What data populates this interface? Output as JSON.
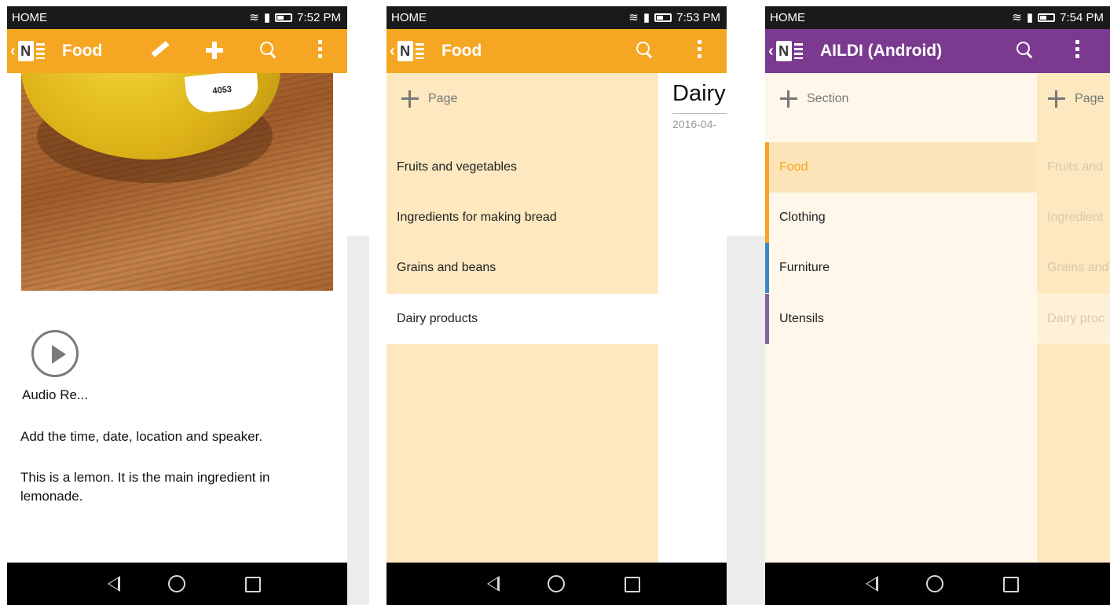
{
  "colors": {
    "food_orange": "#f5a623",
    "notebook_purple": "#7b3a8f",
    "clothing_accent": "#f5a623",
    "furniture_accent": "#3d86c6",
    "utensils_accent": "#8064a2"
  },
  "screen1": {
    "status": {
      "home": "HOME",
      "time": "7:52 PM"
    },
    "appbar": {
      "title": "Food"
    },
    "image_alt_text": {
      "sticker": "4053"
    },
    "audio": {
      "label": "Audio Re..."
    },
    "paragraphs": [
      "Add the time, date, location and speaker.",
      "This is a lemon. It is the main ingredient in lemonade."
    ]
  },
  "screen2": {
    "status": {
      "home": "HOME",
      "time": "7:53 PM"
    },
    "appbar": {
      "title": "Food"
    },
    "add_label": "Page",
    "pages": [
      {
        "label": "Fruits and vegetables"
      },
      {
        "label": "Ingredients for making bread"
      },
      {
        "label": "Grains and beans"
      },
      {
        "label": "Dairy products"
      }
    ],
    "peek": {
      "title": "Dairy",
      "date": "2016-04-"
    }
  },
  "screen3": {
    "status": {
      "home": "HOME",
      "time": "7:54 PM"
    },
    "appbar": {
      "title": "AILDI (Android)"
    },
    "add_label": "Section",
    "peek_add_label": "Page",
    "sections": [
      {
        "label": "Food"
      },
      {
        "label": "Clothing"
      },
      {
        "label": "Furniture"
      },
      {
        "label": "Utensils"
      }
    ],
    "peek_pages": [
      {
        "label": "Fruits and"
      },
      {
        "label": "Ingredient"
      },
      {
        "label": "Grains and"
      },
      {
        "label": "Dairy proc"
      }
    ]
  }
}
